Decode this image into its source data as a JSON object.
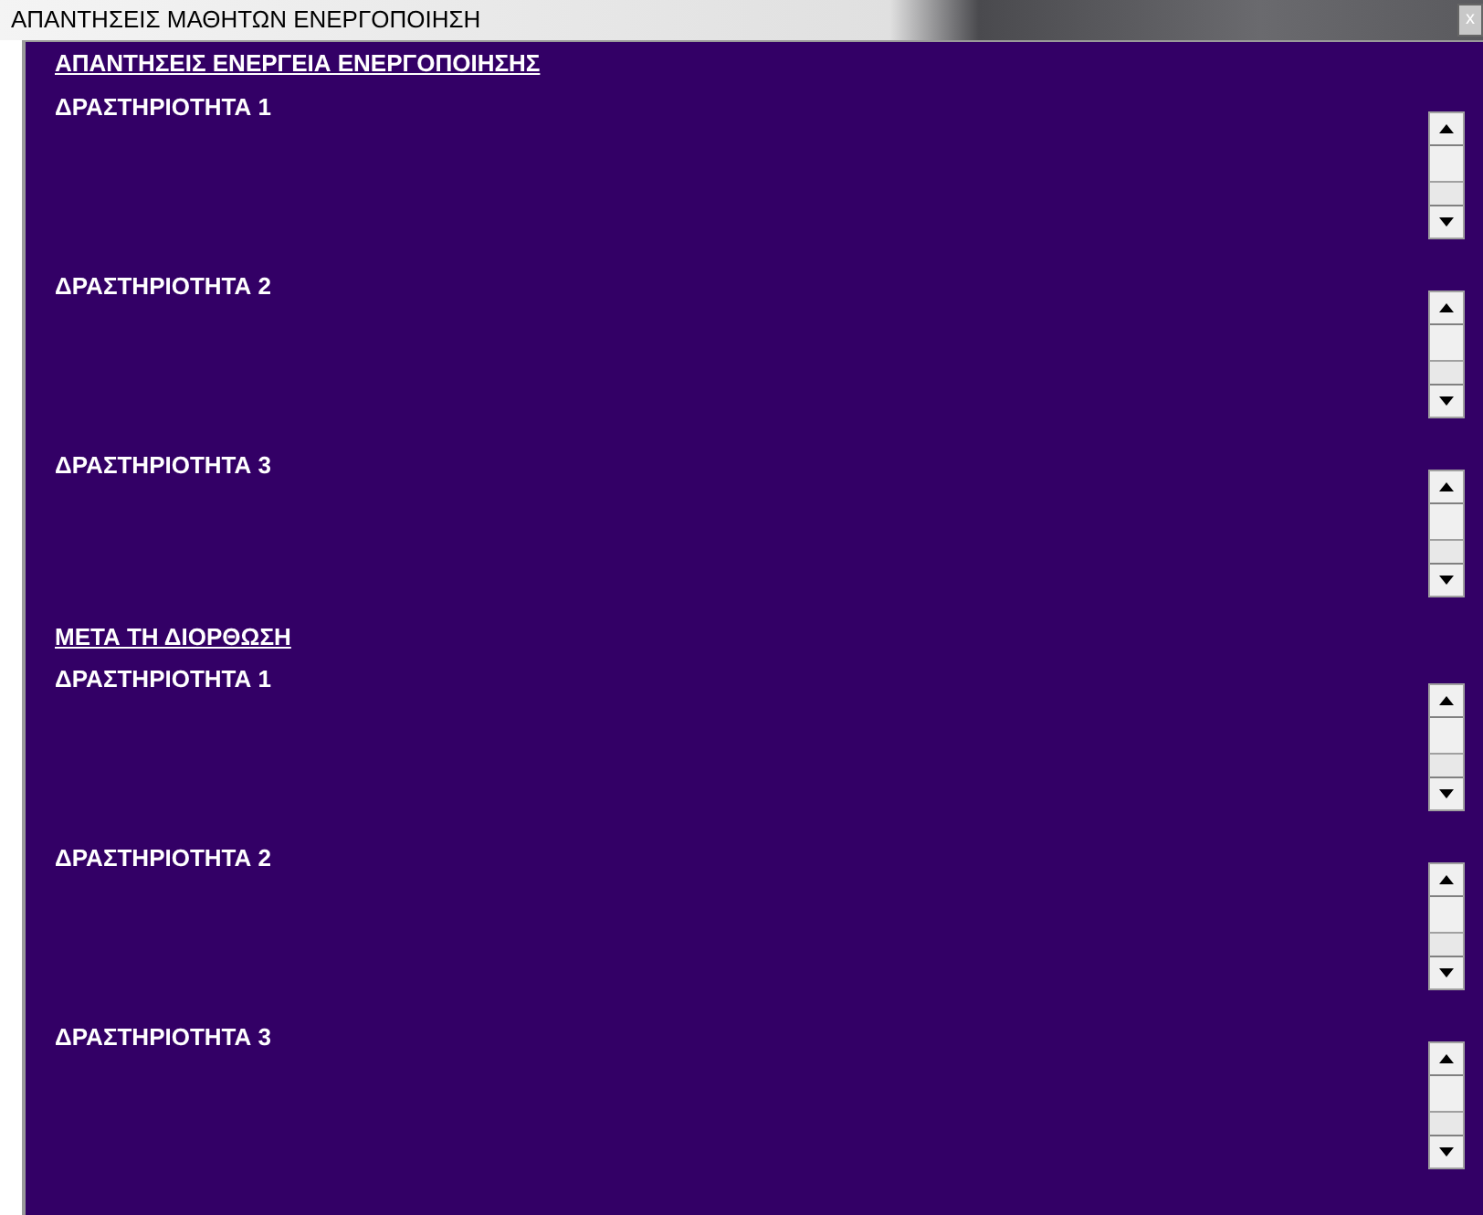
{
  "window": {
    "title": "ΑΠΑΝΤΗΣΕΙΣ ΜΑΘΗΤΩΝ ΕΝΕΡΓΟΠΟΙΗΣΗ",
    "close_button": "x"
  },
  "sections": [
    {
      "heading": "ΑΠΑΝΤΗΣΕΙΣ ΕΝΕΡΓΕΙΑ ΕΝΕΡΓΟΠΟΙΗΣΗΣ",
      "activities": [
        {
          "label": "ΔΡΑΣΤΗΡΙΟΤΗΤΑ 1"
        },
        {
          "label": "ΔΡΑΣΤΗΡΙΟΤΗΤΑ 2"
        },
        {
          "label": "ΔΡΑΣΤΗΡΙΟΤΗΤΑ 3"
        }
      ]
    },
    {
      "heading": "ΜΕΤΑ ΤΗ ΔΙΟΡΘΩΣΗ",
      "activities": [
        {
          "label": "ΔΡΑΣΤΗΡΙΟΤΗΤΑ 1"
        },
        {
          "label": "ΔΡΑΣΤΗΡΙΟΤΗΤΑ 2"
        },
        {
          "label": "ΔΡΑΣΤΗΡΙΟΤΗΤΑ 3"
        }
      ]
    }
  ]
}
